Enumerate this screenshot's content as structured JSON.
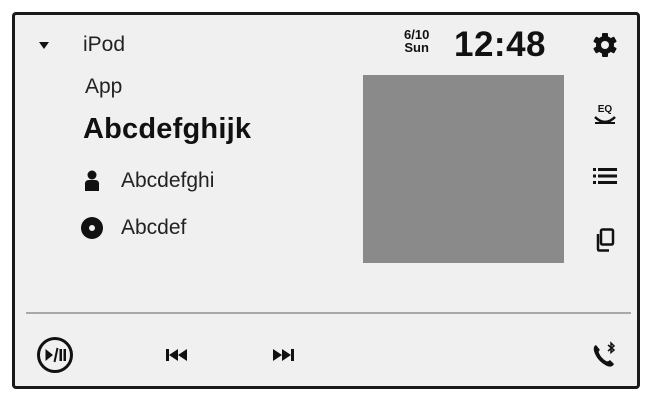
{
  "source": {
    "label": "iPod"
  },
  "now_playing": {
    "app": "App",
    "song": "Abcdefghijk",
    "artist": "Abcdefghi",
    "album": "Abcdef"
  },
  "clock": {
    "date": "6/10",
    "day": "Sun",
    "time": "12:48"
  },
  "side_buttons": {
    "eq_label": "EQ"
  },
  "icons": {
    "source_menu": "triangle-down-icon",
    "artist": "person-icon",
    "album": "disc-icon",
    "settings": "gear-icon",
    "eq": "eq-icon",
    "list": "list-icon",
    "browse": "copy-icon",
    "play_pause": "play-pause-icon",
    "previous": "skip-previous-icon",
    "next": "skip-next-icon",
    "phone": "bluetooth-phone-icon"
  },
  "colors": {
    "background": "#f0f0f0",
    "artwork": "#8a8a8a",
    "foreground": "#111111"
  }
}
